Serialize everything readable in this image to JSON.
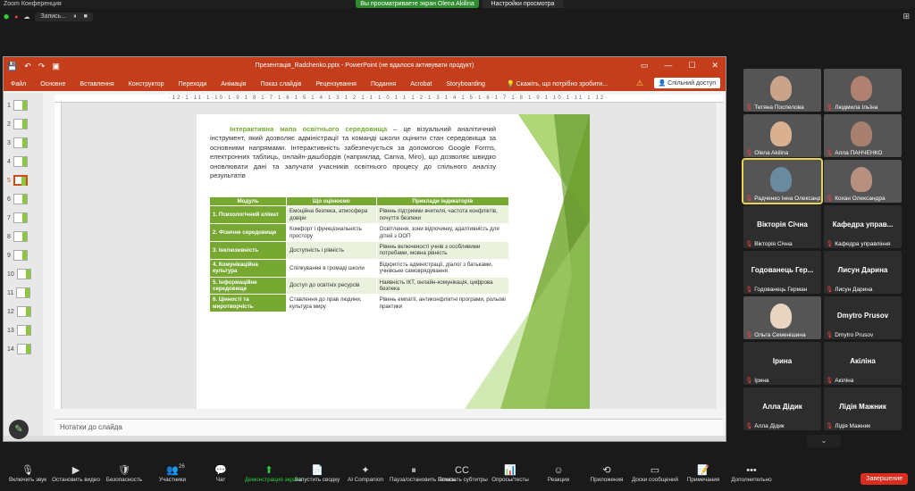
{
  "zoom": {
    "window_title": "Zoom Конференция",
    "share_banner": "Вы просматриваете экран Olena Akilina",
    "view_settings": "Настройки просмотра",
    "recording_label": "Запись..."
  },
  "ppt": {
    "title": "Презентація_Radchenko.pptx - PowerPoint (не вдалося активувати продукт)",
    "tabs": [
      "Файл",
      "Основне",
      "Вставлення",
      "Конструктор",
      "Переходи",
      "Анімація",
      "Показ слайдів",
      "Рецензування",
      "Подання",
      "Acrobat",
      "Storyboarding"
    ],
    "tell_me": "Скажіть, що потрібно зробити...",
    "share_button": "Спільний доступ",
    "ruler": "·12·1·11·1·10·1·9·1·8·1·7·1·6·1·5·1·4·1·3·1·2·1·1·1·0·1·1·1·2·1·3·1·4·1·5·1·6·1·7·1·8·1·9·1·10·1·11·1·12·",
    "notes_placeholder": "Нотатки до слайда",
    "thumbnails": [
      "1",
      "2",
      "3",
      "4",
      "5",
      "6",
      "7",
      "8",
      "9",
      "10",
      "11",
      "12",
      "13",
      "14"
    ],
    "active_slide": "5"
  },
  "slide": {
    "heading": "Інтерактивна мапа освітнього середовища",
    "body": " – це візуальний аналітичний інструмент, який дозволяє адміністрації та команді школи оцінити стан середовища за основними напрямами. Інтерактивність забезпечується за допомогою Google Forms, електронних таблиць, онлайн-дашбордів (наприклад, Canva, Miro), що дозволяє швидко оновлювати дані та залучати учасників освітнього процесу до спільного аналізу результатів",
    "table": {
      "headers": [
        "Модуль",
        "Що оцінюємо",
        "Приклади індикаторів"
      ],
      "rows": [
        [
          "1. Психологічний клімат",
          "Емоційна безпека, атмосфера довіри",
          "Рівень підтримки вчителя, частота конфліктів, почуття безпеки"
        ],
        [
          "2. Фізичне середовище",
          "Комфорт і функціональність простору",
          "Освітлення, зони відпочинку, адаптивність для дітей з ООП"
        ],
        [
          "3. Інклюзивність",
          "Доступність і рівність",
          "Рівень включеності учнів з особливими потребами, мовна рівність"
        ],
        [
          "4. Комунікаційна культура",
          "Спілкування в громаді школи",
          "Відкритість адміністрації, діалог з батьками, учнівське самоврядування"
        ],
        [
          "5. Інформаційне середовище",
          "Доступ до освітніх ресурсів",
          "Наявність ІКТ, онлайн-комунікація, цифрова безпека"
        ],
        [
          "6. Цінності та миротворчість",
          "Ставлення до прав людини, культура миру",
          "Рівень емпатії, антиконфліктні програми, рольові практики"
        ]
      ]
    }
  },
  "participants": [
    {
      "name": "Тетяна Поспелова",
      "big": "",
      "video": true,
      "face": "#c9a38a"
    },
    {
      "name": "Людмила Ільїна",
      "big": "",
      "video": true,
      "face": "#b08070"
    },
    {
      "name": "Olena Akilina",
      "big": "",
      "video": true,
      "face": "#d9b090"
    },
    {
      "name": "Алла ПАНЧЕНКО",
      "big": "",
      "video": true,
      "face": "#a88070"
    },
    {
      "name": "Радченко Інна Олександ...",
      "big": "",
      "video": true,
      "face": "#6a8aa0",
      "active": true
    },
    {
      "name": "Кохан Олександра",
      "big": "",
      "video": true,
      "face": "#b89080"
    },
    {
      "name": "Вікторія Січна",
      "big": "Вікторія Січна",
      "video": false
    },
    {
      "name": "Кафедра управління",
      "big": "Кафедра управ...",
      "video": false
    },
    {
      "name": "Годованець Герман",
      "big": "Годованець Гер...",
      "video": false
    },
    {
      "name": "Лисун  Дарина",
      "big": "Лисун  Дарина",
      "video": false
    },
    {
      "name": "Ольга Семенішина",
      "big": "",
      "video": true,
      "face": "#e8d4c0"
    },
    {
      "name": "Dmytro Prusov",
      "big": "Dmytro Prusov",
      "video": false
    },
    {
      "name": "Ірина",
      "big": "Ірина",
      "video": false
    },
    {
      "name": "Акіліна",
      "big": "Акіліна",
      "video": false
    },
    {
      "name": "Алла Дідик",
      "big": "Алла Дідик",
      "video": false
    },
    {
      "name": "Лідія Мажник",
      "big": "Лідія Мажник",
      "video": false
    }
  ],
  "toolbar": {
    "items": [
      {
        "label": "Включить звук",
        "icon": "🎙"
      },
      {
        "label": "Остановить видео",
        "icon": "▶"
      },
      {
        "label": "Безопасность",
        "icon": "🛡"
      },
      {
        "label": "Участники",
        "icon": "👥"
      },
      {
        "label": "Чат",
        "icon": "💬"
      },
      {
        "label": "Демонстрация экрана",
        "icon": "⬆"
      },
      {
        "label": "Запустить сводку",
        "icon": "📄"
      },
      {
        "label": "AI Companion",
        "icon": "✦"
      },
      {
        "label": "Пауза/остановить запись",
        "icon": "⏸"
      },
      {
        "label": "Показать субтитры",
        "icon": "CC"
      },
      {
        "label": "Опросы/тесты",
        "icon": "📊"
      },
      {
        "label": "Реакции",
        "icon": "☺"
      },
      {
        "label": "Приложения",
        "icon": "⟲"
      },
      {
        "label": "Доски сообщений",
        "icon": "▭"
      },
      {
        "label": "Примечания",
        "icon": "📝"
      },
      {
        "label": "Дополнительно",
        "icon": "•••"
      }
    ],
    "participant_count": "26",
    "end_label": "Завершение"
  },
  "colors": {
    "accent_green": "#76a832",
    "ppt_red": "#c43e1c",
    "share_green": "#2e8b2e",
    "end_red": "#d92d20"
  }
}
